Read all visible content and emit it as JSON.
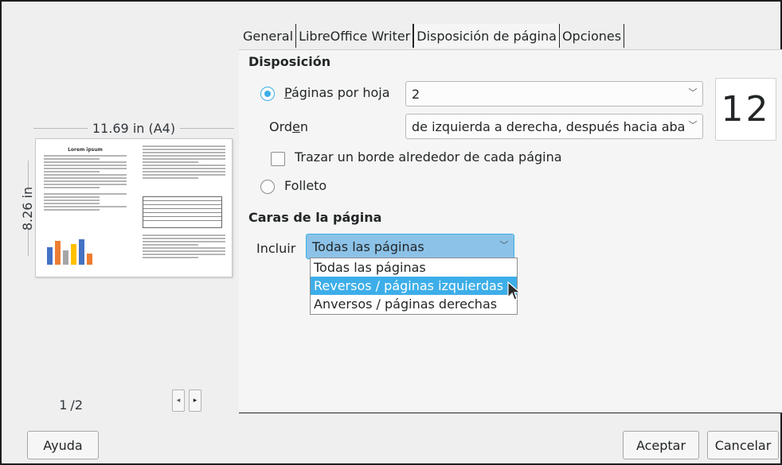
{
  "tabs": [
    "General",
    "LibreOffice Writer",
    "Disposición de página",
    "Opciones"
  ],
  "active_tab": "Disposición de página",
  "preview": {
    "width_label": "11.69 in (A4)",
    "height_label": "8.26 in",
    "page_current": "1",
    "page_total": "/2",
    "mini_title": "Lorem ipsum"
  },
  "layout": {
    "heading": "Disposición",
    "pages_per_sheet_label": "Páginas por hoja",
    "pages_per_sheet_value": "2",
    "order_label": "Orden",
    "order_value": "de izquierda a derecha, después hacia abajo",
    "border_label": "Trazar un borde alrededor de cada página",
    "brochure_label": "Folleto",
    "pages_preview": "12"
  },
  "sides": {
    "heading": "Caras de la página",
    "include_label": "Incluir",
    "include_value": "Todas las páginas",
    "options": [
      "Todas las páginas",
      "Reversos / páginas izquierdas",
      "Anversos / páginas derechas"
    ],
    "highlighted_option": "Reversos / páginas izquierdas"
  },
  "buttons": {
    "help": "Ayuda",
    "ok": "Aceptar",
    "cancel": "Cancelar"
  },
  "colors": {
    "accent": "#3daee9",
    "dropdown_open_bg": "#8cc2e8",
    "panel_bg": "#f5f5f5",
    "window_bg": "#efefef"
  },
  "icons": [
    "chevron-down-icon",
    "chevron-left-icon",
    "chevron-right-icon",
    "mouse-pointer-icon"
  ]
}
